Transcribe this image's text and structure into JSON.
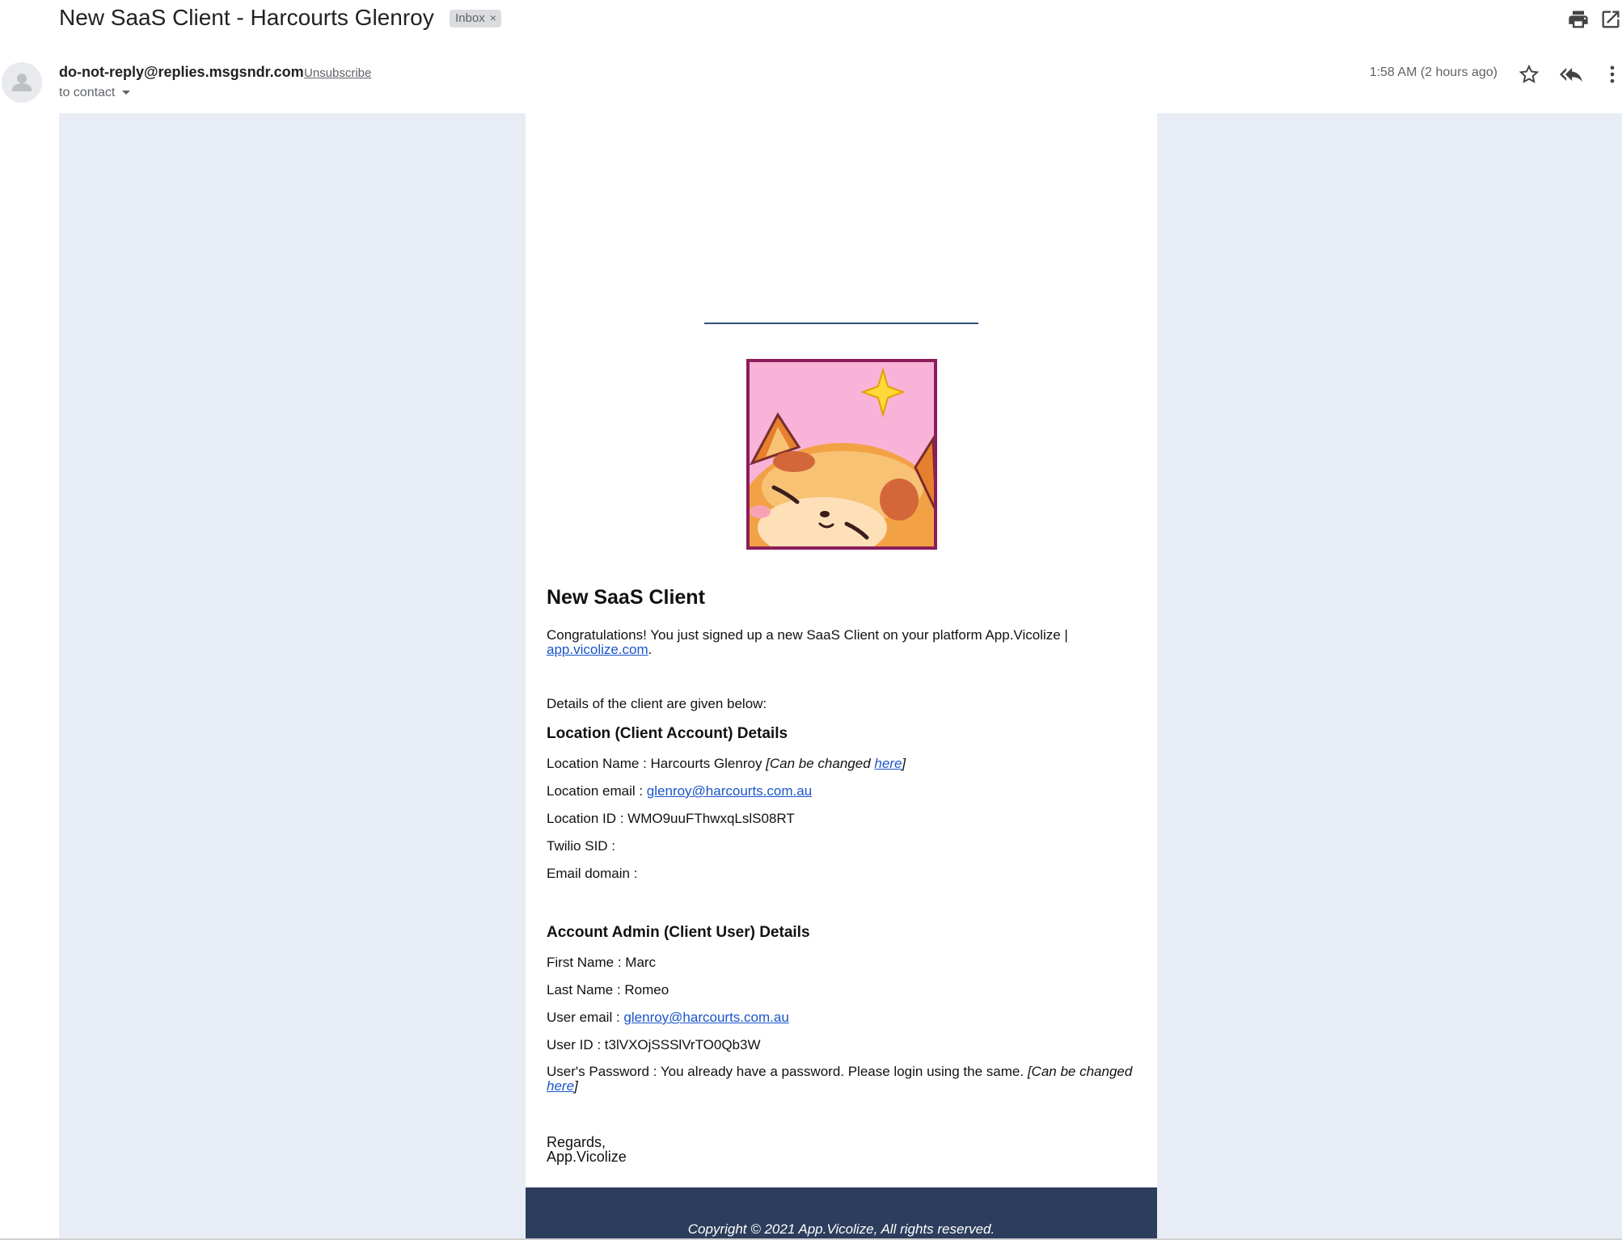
{
  "header": {
    "subject": "New SaaS Client - Harcourts Glenroy",
    "label_chip": "Inbox",
    "label_chip_close": "×",
    "icons": [
      "print-icon",
      "open-in-new-window-icon"
    ]
  },
  "message": {
    "sender": "do-not-reply@replies.msgsndr.com",
    "unsubscribe": "Unsubscribe",
    "to": "to contact",
    "time": "1:58 AM (2 hours ago)",
    "icons": [
      "star-icon",
      "reply-all-icon",
      "more-vert-icon"
    ]
  },
  "email": {
    "background_color": "#e8edf5",
    "footer_color": "#2c3e5c",
    "title": "New SaaS Client",
    "congrats_text": "Congratulations! You just signed up a new SaaS Client on your platform App.Vicolize |",
    "congrats_link": "app.vicolize.com",
    "congrats_end": ".",
    "details_intro": "Details of the client are given below:",
    "location_heading": "Location (Client Account) Details",
    "location": {
      "name_label": "Location Name : Harcourts Glenroy ",
      "name_note_open": "[Can be changed ",
      "name_note_link": "here",
      "name_note_close": "]",
      "email_label": "Location email : ",
      "email_value": "glenroy@harcourts.com.au",
      "id_label": "Location ID : WMO9uuFThwxqLslS08RT",
      "twilio_label": "Twilio SID :",
      "domain_label": "Email domain :"
    },
    "admin_heading": "Account Admin (Client User) Details",
    "admin": {
      "first_name": "First Name : Marc",
      "last_name": "Last Name : Romeo",
      "email_label": "User email : ",
      "email_value": "glenroy@harcourts.com.au",
      "user_id": "User ID : t3lVXOjSSSlVrTO0Qb3W",
      "password_label": "User's Password : You already have a password. Please login using the same. ",
      "password_note_open": "[Can be changed ",
      "password_note_link": "here",
      "password_note_close": "]"
    },
    "regards": "Regards,",
    "signature": "App.Vicolize",
    "footer": "Copyright © 2021  App.Vicolize, All rights reserved."
  }
}
